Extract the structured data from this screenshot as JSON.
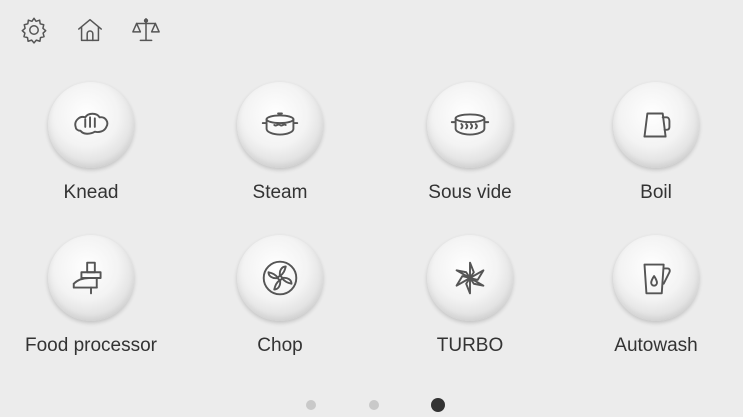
{
  "toolbar": {
    "icons": [
      "gear-icon",
      "home-icon",
      "scale-icon"
    ]
  },
  "tiles": [
    {
      "label": "Knead",
      "icon": "knead-icon"
    },
    {
      "label": "Steam",
      "icon": "steam-icon"
    },
    {
      "label": "Sous vide",
      "icon": "sous-vide-icon"
    },
    {
      "label": "Boil",
      "icon": "kettle-icon"
    },
    {
      "label": "Food processor",
      "icon": "food-processor-icon"
    },
    {
      "label": "Chop",
      "icon": "chop-icon"
    },
    {
      "label": "TURBO",
      "icon": "turbo-icon"
    },
    {
      "label": "Autowash",
      "icon": "autowash-icon"
    }
  ],
  "pagination": {
    "pages": 3,
    "active_page": 3
  },
  "colors": {
    "background": "#ececec",
    "icon_stroke": "#555555",
    "label_text": "#333333",
    "dot_inactive": "#c9c9c9",
    "dot_active": "#333333"
  }
}
